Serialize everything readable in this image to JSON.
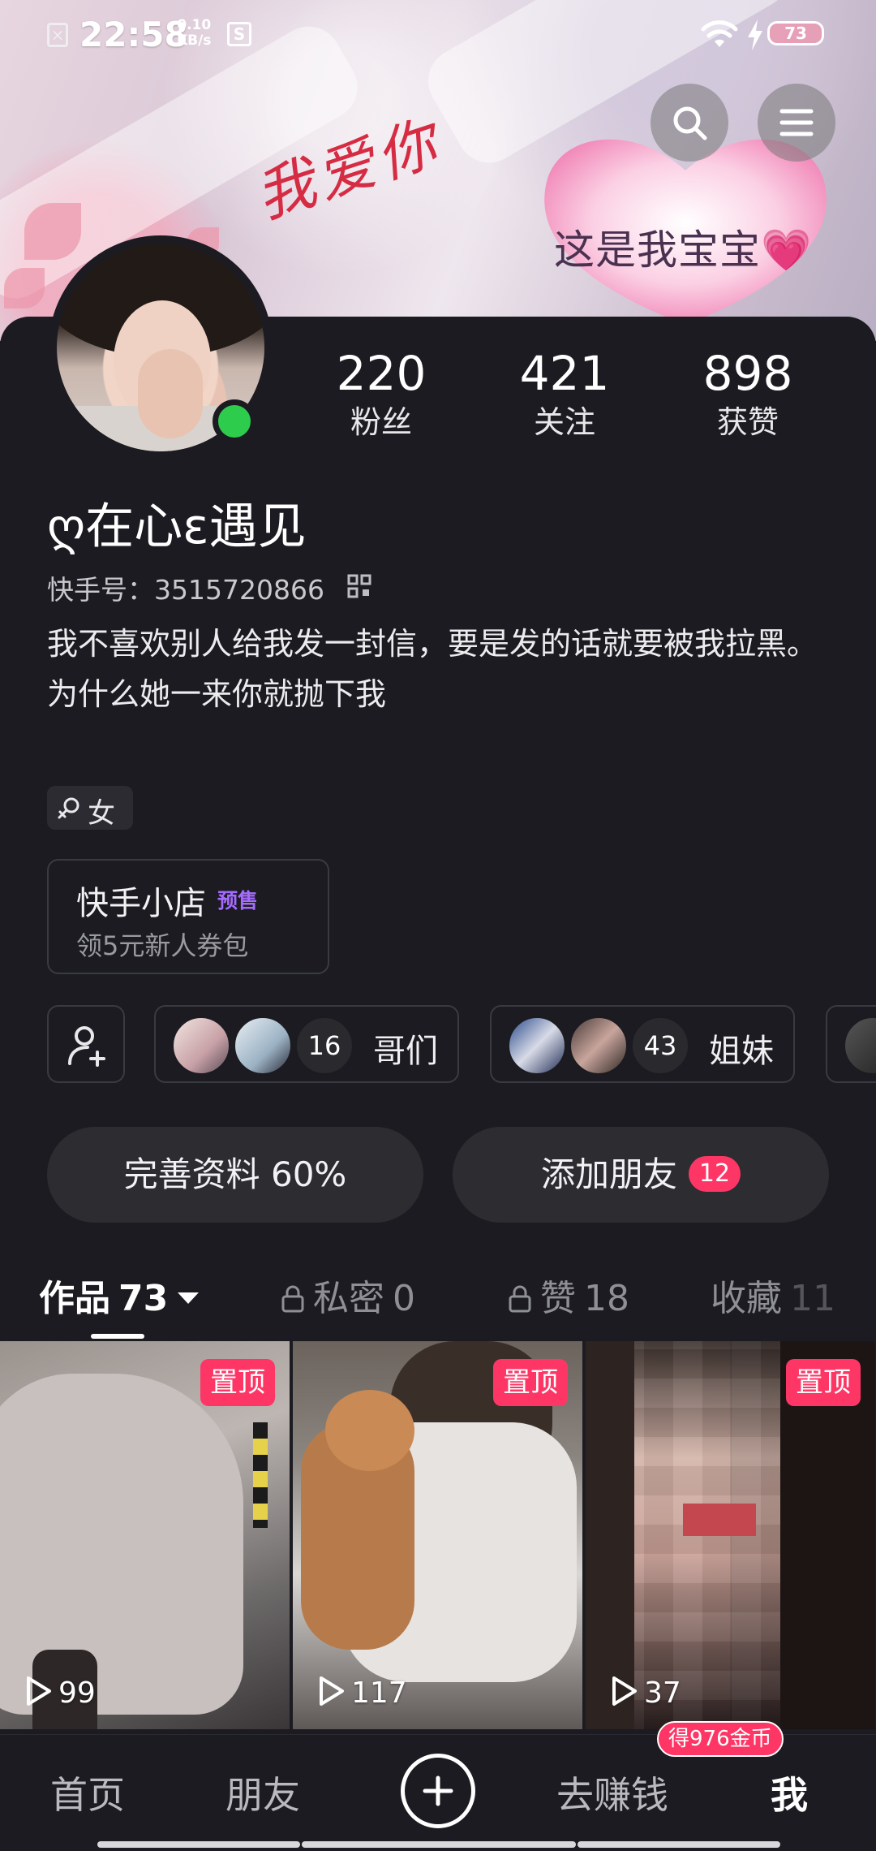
{
  "status_bar": {
    "time": "22:58",
    "net_speed_value": "0.10",
    "net_speed_unit": "KB/s",
    "battery": "73"
  },
  "banner": {
    "script_text": "我爱你",
    "heart_text": "这是我宝宝💗"
  },
  "profile": {
    "stats": [
      {
        "value": "220",
        "label": "粉丝"
      },
      {
        "value": "421",
        "label": "关注"
      },
      {
        "value": "898",
        "label": "获赞"
      }
    ],
    "nickname": "ღ在心ε遇见",
    "kuaishou_id_label": "快手号：",
    "kuaishou_id": "3515720866",
    "bio_line1": "我不喜欢别人给我发一封信，要是发的话就要被我拉黑。",
    "bio_line2": "为什么她一来你就抛下我",
    "gender": "女",
    "status_color": "#2ecc4c"
  },
  "shop": {
    "title": "快手小店",
    "badge": "预售",
    "subtitle": "领5元新人券包"
  },
  "groups": [
    {
      "count": "16",
      "name": "哥们"
    },
    {
      "count": "43",
      "name": "姐妹"
    }
  ],
  "actions": {
    "complete_profile": "完善资料 60%",
    "add_friend": "添加朋友",
    "add_friend_badge": "12"
  },
  "tabs": [
    {
      "label": "作品",
      "count": "73"
    },
    {
      "label": "私密",
      "count": "0"
    },
    {
      "label": "赞",
      "count": "18"
    },
    {
      "label": "收藏",
      "count": "11"
    }
  ],
  "videos": [
    {
      "pinned_label": "置顶",
      "plays": "99"
    },
    {
      "pinned_label": "置顶",
      "plays": "117"
    },
    {
      "pinned_label": "置顶",
      "plays": "37"
    }
  ],
  "bottom_nav": {
    "home": "首页",
    "friends": "朋友",
    "earn": "去赚钱",
    "me": "我",
    "coin_badge": "得976金币"
  },
  "colors": {
    "background": "#1b1b21",
    "accent_red": "#fe3666",
    "shop_badge": "#a56bff"
  }
}
